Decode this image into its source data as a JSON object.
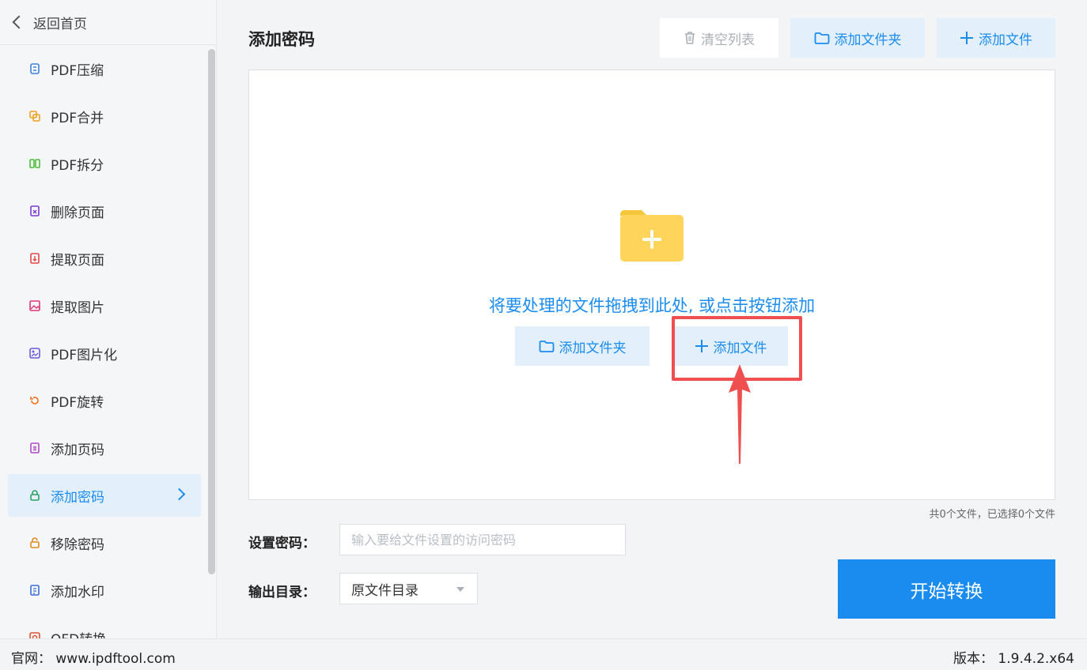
{
  "sidebar": {
    "back_label": "返回首页",
    "items": [
      {
        "label": "PDF压缩",
        "icon": "compress-icon",
        "color": "#3b82d6"
      },
      {
        "label": "PDF合并",
        "icon": "merge-icon",
        "color": "#f0a020"
      },
      {
        "label": "PDF拆分",
        "icon": "split-icon",
        "color": "#4cc038"
      },
      {
        "label": "删除页面",
        "icon": "delete-page-icon",
        "color": "#7a3bd0"
      },
      {
        "label": "提取页面",
        "icon": "extract-page-icon",
        "color": "#e04848"
      },
      {
        "label": "提取图片",
        "icon": "extract-image-icon",
        "color": "#e0357a"
      },
      {
        "label": "PDF图片化",
        "icon": "pdf-to-image-icon",
        "color": "#6a5ad8"
      },
      {
        "label": "PDF旋转",
        "icon": "rotate-icon",
        "color": "#f07020"
      },
      {
        "label": "添加页码",
        "icon": "page-number-icon",
        "color": "#b048c8"
      },
      {
        "label": "添加密码",
        "icon": "lock-icon",
        "color": "#2aa060"
      },
      {
        "label": "移除密码",
        "icon": "unlock-icon",
        "color": "#e08a20"
      },
      {
        "label": "添加水印",
        "icon": "watermark-icon",
        "color": "#3b6ed6"
      },
      {
        "label": "OFD转换",
        "icon": "ofd-icon",
        "color": "#e05030"
      }
    ],
    "active_index": 9
  },
  "main": {
    "title": "添加密码",
    "toolbar": {
      "clear_label": "清空列表",
      "add_folder_label": "添加文件夹",
      "add_file_label": "添加文件"
    },
    "dropzone": {
      "hint": "将要处理的文件拖拽到此处, 或点击按钮添加",
      "add_folder_label": "添加文件夹",
      "add_file_label": "添加文件"
    },
    "file_count": "共0个文件，已选择0个文件",
    "password": {
      "label": "设置密码：",
      "placeholder": "输入要给文件设置的访问密码",
      "value": ""
    },
    "output": {
      "label": "输出目录：",
      "selected": "原文件目录"
    },
    "start_label": "开始转换"
  },
  "footer": {
    "site": "官网： www.ipdftool.com",
    "version": "版本： 1.9.4.2.x64"
  },
  "colors": {
    "accent": "#1a8cf0",
    "accent_light": "#e3f0fc",
    "highlight_red": "#ef4f4f",
    "folder_yellow": "#ffd45a"
  }
}
